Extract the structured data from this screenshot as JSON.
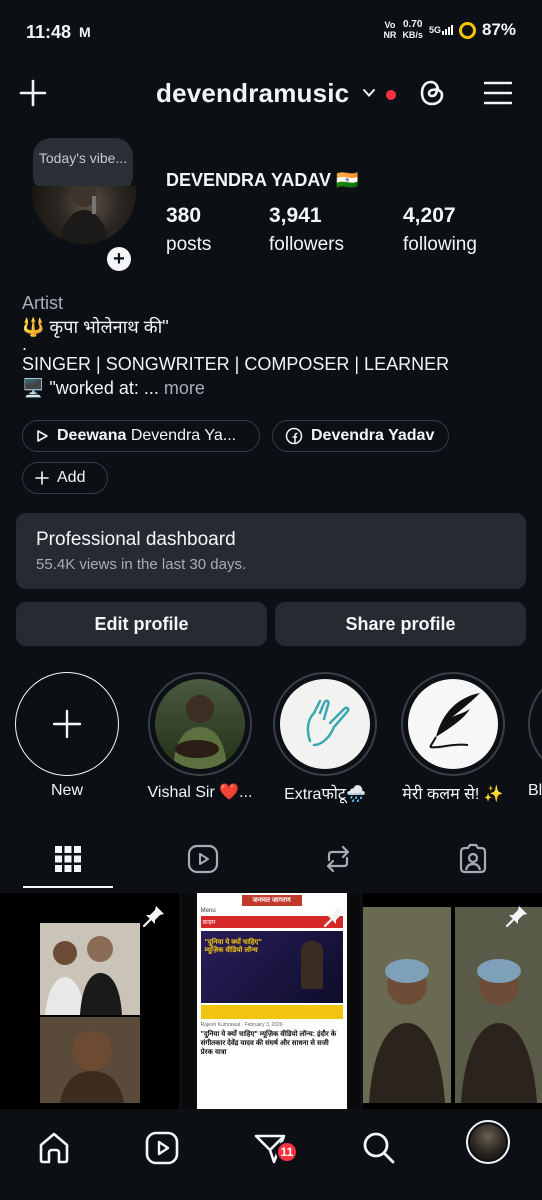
{
  "status_bar": {
    "time": "11:48",
    "carrier_icon": "M",
    "net_top": "Vo",
    "net_bottom": "NR",
    "speed_value": "0.70",
    "speed_unit": "KB/s",
    "signal_type": "5G",
    "battery": "87%"
  },
  "header": {
    "username": "devendramusic",
    "icons": [
      "plus-icon",
      "chevron-down-icon",
      "threads-icon",
      "menu-icon"
    ],
    "notification_dot_color": "#ff3040"
  },
  "profile": {
    "note": "Today's vibe...",
    "display_name": "DEVENDRA YADAV 🇮🇳",
    "stats": [
      {
        "value": "380",
        "label": "posts"
      },
      {
        "value": "3,941",
        "label": "followers"
      },
      {
        "value": "4,207",
        "label": "following"
      }
    ],
    "category": "Artist",
    "bio_line1": "🔱 कृपा भोलेनाथ की\"",
    "bio_line2": ".",
    "bio_line3": "SINGER | SONGWRITER | COMPOSER | LEARNER",
    "bio_line4": "🖥️ \"worked at: ...",
    "bio_more": "more"
  },
  "chips": {
    "music_bold": "Deewana",
    "music_rest": "Devendra Ya...",
    "facebook": "Devendra Yadav",
    "add": "Add"
  },
  "dashboard": {
    "title": "Professional dashboard",
    "subtitle": "55.4K views in the last 30 days."
  },
  "buttons": {
    "edit": "Edit profile",
    "share": "Share profile"
  },
  "highlights": [
    {
      "label": "New"
    },
    {
      "label": "Vishal Sir ❤️..."
    },
    {
      "label": "Extraफोटू🌧️"
    },
    {
      "label": "मेरी कलम से! ✨"
    },
    {
      "label": "Bl"
    }
  ],
  "tabs": [
    "grid-icon",
    "reels-icon",
    "reposts-icon",
    "tagged-icon"
  ],
  "posts": [
    {
      "pinned": true
    },
    {
      "pinned": true,
      "brand": "जनमत जागरण",
      "menu": "Menu",
      "section": "क्राइम",
      "headline_small": "\"दुनिया ये क्यों चाहिए\" म्यूज़िक वीडियो लॉन्च",
      "byline": "Rajesh Kumrawat",
      "date": "February 3, 2026",
      "headline": "\"दुनिया ये क्यों चाहिए\" म्यूज़िक वीडियो लॉन्च: इंदौर के संगीतकार देवेंद्र यादव की संघर्ष और साधना से सजी प्रेरक यात्रा"
    },
    {
      "pinned": true
    }
  ],
  "bottom_nav": {
    "items": [
      "home-icon",
      "reels-icon",
      "messages-icon",
      "search-icon",
      "profile-avatar"
    ],
    "badge": "11"
  }
}
